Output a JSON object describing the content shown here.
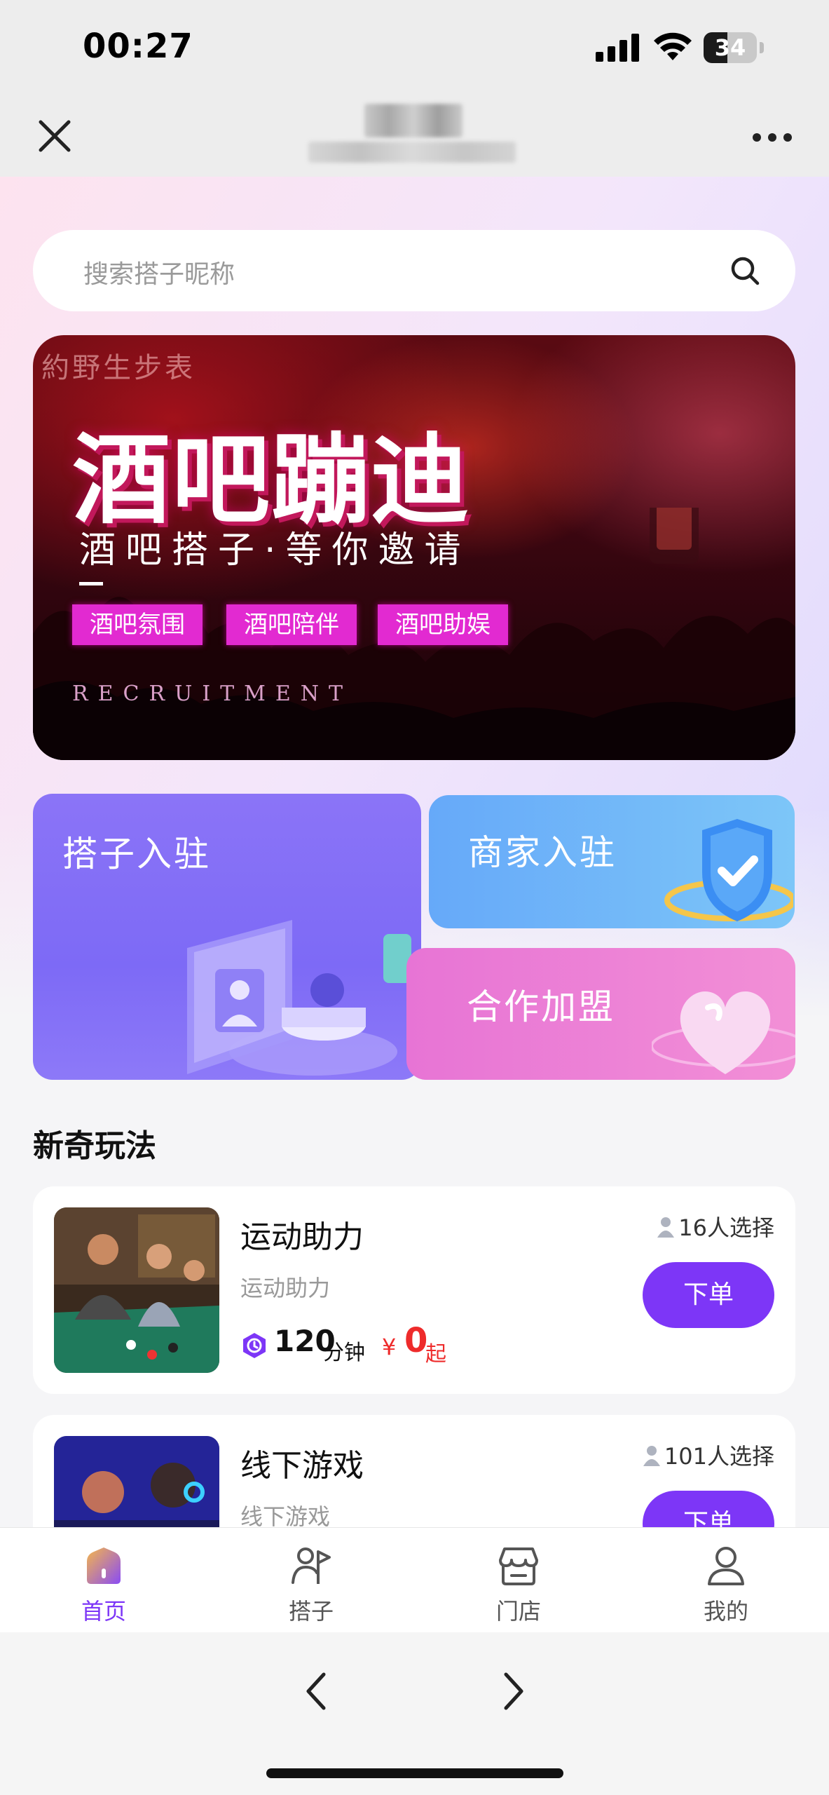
{
  "status_bar": {
    "time": "00:27",
    "battery": "34"
  },
  "search": {
    "placeholder": "搜索搭子昵称"
  },
  "banner": {
    "sign": "約野生步表",
    "title": "酒吧蹦迪",
    "subtitle": "酒吧搭子·等你邀请",
    "tags": [
      "酒吧氛围",
      "酒吧陪伴",
      "酒吧助娱"
    ],
    "recruit": "RECRUITMENT"
  },
  "cards": {
    "partner_join": "搭子入驻",
    "merchant_join": "商家入驻",
    "cooperation": "合作加盟"
  },
  "section": {
    "title": "新奇玩法"
  },
  "items": [
    {
      "name": "运动助力",
      "desc": "运动助力",
      "duration": "120",
      "duration_unit": "分钟",
      "currency": "¥",
      "price": "0",
      "price_suffix": "起",
      "count": "16人选择",
      "button": "下单"
    },
    {
      "name": "线下游戏",
      "desc": "线下游戏",
      "count": "101人选择",
      "button": "下单"
    }
  ],
  "tabbar": [
    {
      "label": "首页",
      "icon": "home-icon",
      "active": true
    },
    {
      "label": "搭子",
      "icon": "partner-icon",
      "active": false
    },
    {
      "label": "门店",
      "icon": "store-icon",
      "active": false
    },
    {
      "label": "我的",
      "icon": "profile-icon",
      "active": false
    }
  ],
  "colors": {
    "accent": "#7d36f7",
    "price": "#ee2b2b"
  }
}
